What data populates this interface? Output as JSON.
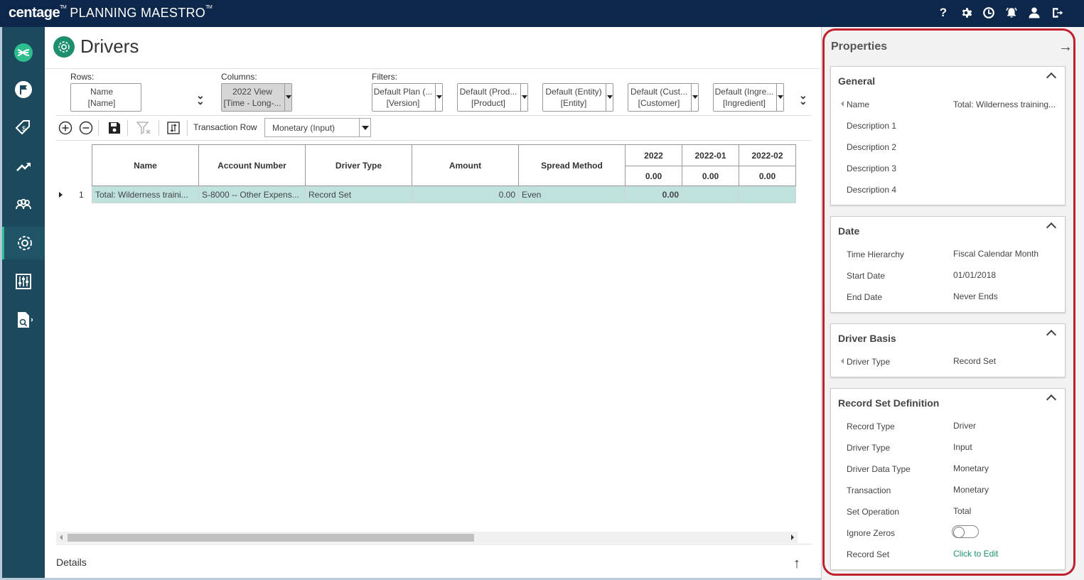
{
  "app": {
    "brand": "centage",
    "brand_tm": "TM",
    "product": "PLANNING MAESTRO",
    "product_tm": "TM",
    "top_icons": [
      "help-icon",
      "settings-icon",
      "clock-icon",
      "alerts-icon",
      "user-icon",
      "logout-icon"
    ],
    "top_icon_glyphs": [
      "?",
      "⚙",
      "◷",
      "🔔",
      "👤",
      "⇥"
    ]
  },
  "sidebar": {
    "items": [
      "logo-icon",
      "flag-icon",
      "budget-tag-icon",
      "trend-icon",
      "people-icon",
      "settings-gear-icon",
      "sliders-icon",
      "report-icon"
    ],
    "active": "settings-gear-icon"
  },
  "page": {
    "title": "Drivers"
  },
  "pivot": {
    "rows_label": "Rows:",
    "columns_label": "Columns:",
    "filters_label": "Filters:",
    "rows_picker": {
      "line1": "Name",
      "line2": "[Name]"
    },
    "columns_picker": {
      "line1": "2022 View",
      "line2": "[Time - Long-..."
    },
    "filters": [
      {
        "line1": "Default Plan (...",
        "line2": "[Version]"
      },
      {
        "line1": "Default (Prod...",
        "line2": "[Product]"
      },
      {
        "line1": "Default (Entity)",
        "line2": "[Entity]"
      },
      {
        "line1": "Default (Cust...",
        "line2": "[Customer]"
      },
      {
        "line1": "Default (Ingre...",
        "line2": "[Ingredient]"
      }
    ]
  },
  "toolbar": {
    "transaction_label": "Transaction Row",
    "transaction_value": "Monetary (Input)"
  },
  "grid": {
    "columns": [
      "Name",
      "Account Number",
      "Driver Type",
      "Amount",
      "Spread Method"
    ],
    "period_columns": [
      "2022",
      "2022-01",
      "2022-02"
    ],
    "period_totals": [
      "0.00",
      "0.00",
      "0.00"
    ],
    "rows": [
      {
        "num": "1",
        "name": "Total: Wilderness traini...",
        "account": "S-8000 -- Other Expens...",
        "driver_type": "Record Set",
        "amount": "0.00",
        "spread": "Even",
        "p2022": "0.00",
        "p202201": "",
        "p202202": ""
      }
    ]
  },
  "details": {
    "label": "Details"
  },
  "properties": {
    "title": "Properties",
    "general": {
      "title": "General",
      "name_label": "Name",
      "name_value": "Total: Wilderness training...",
      "desc1": "Description 1",
      "desc2": "Description 2",
      "desc3": "Description 3",
      "desc4": "Description 4"
    },
    "date": {
      "title": "Date",
      "time_hierarchy_label": "Time Hierarchy",
      "time_hierarchy_value": "Fiscal Calendar Month",
      "start_label": "Start Date",
      "start_value": "01/01/2018",
      "end_label": "End Date",
      "end_value": "Never Ends"
    },
    "driver_basis": {
      "title": "Driver Basis",
      "driver_type_label": "Driver Type",
      "driver_type_value": "Record Set"
    },
    "record_set": {
      "title": "Record Set Definition",
      "record_type_label": "Record Type",
      "record_type_value": "Driver",
      "driver_type_label": "Driver Type",
      "driver_type_value": "Input",
      "driver_data_type_label": "Driver Data Type",
      "driver_data_type_value": "Monetary",
      "transaction_label": "Transaction",
      "transaction_value": "Monetary",
      "set_operation_label": "Set Operation",
      "set_operation_value": "Total",
      "ignore_zeros_label": "Ignore Zeros",
      "ignore_zeros_value": false,
      "record_set_label": "Record Set",
      "record_set_value": "Click to Edit"
    }
  },
  "colors": {
    "topbar": "#0c2749",
    "sidebar": "#1c4a5c",
    "accent": "#1e8f6e",
    "selected_row": "#bfe3dc",
    "highlight_ring": "#c0202e"
  }
}
